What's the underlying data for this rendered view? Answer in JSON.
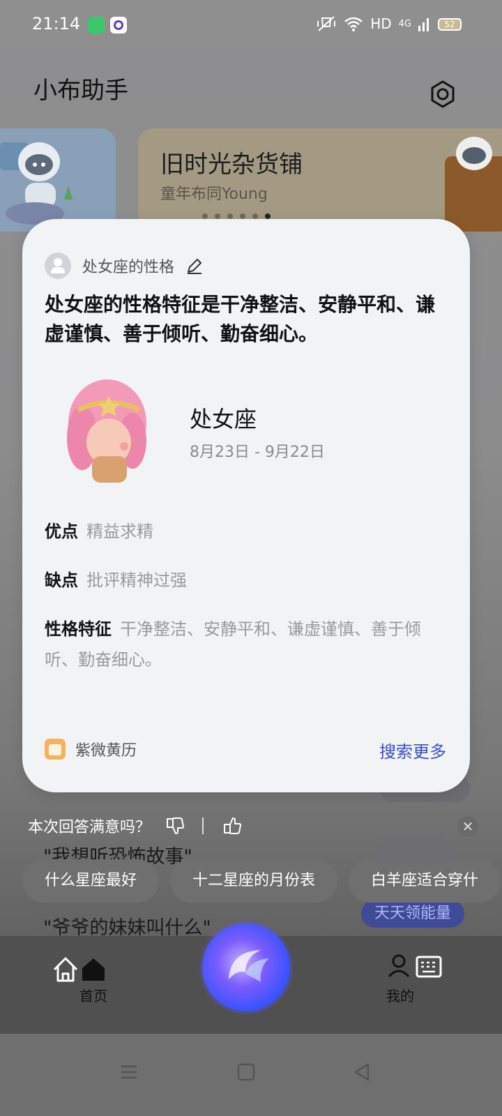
{
  "status_bar": {
    "time": "21:14",
    "network": "HD",
    "signal": "4G",
    "battery": "52"
  },
  "app": {
    "title": "小布助手"
  },
  "banner": {
    "title": "旧时光杂货铺",
    "subtitle": "童年布同Young",
    "dot_count": 6,
    "active_dot": 5
  },
  "card": {
    "question": "处女座的性格",
    "answer": "处女座的性格特征是干净整洁、安静平和、谦虚谨慎、善于倾听、勤奋细心。",
    "sign_name": "处女座",
    "sign_dates": "8月23日 - 9月22日",
    "attributes": [
      {
        "key": "优点",
        "value": "精益求精"
      },
      {
        "key": "缺点",
        "value": "批评精神过强"
      },
      {
        "key": "性格特征",
        "value": "干净整洁、安静平和、谦虚谨慎、善于倾听、勤奋细心。"
      }
    ],
    "source": "紫微黄历",
    "more_label": "搜索更多"
  },
  "background_suggestions": {
    "q1": "\"我想听恐怖故事\"",
    "q2": "\"爷爷的妹妹叫什么\"",
    "energy_label": "天天领能量"
  },
  "feedback": {
    "prompt": "本次回答满意吗？"
  },
  "chips": [
    "什么星座最好",
    "十二星座的月份表",
    "白羊座适合穿什"
  ],
  "nav": {
    "home_label": "首页",
    "mine_label": "我的"
  }
}
